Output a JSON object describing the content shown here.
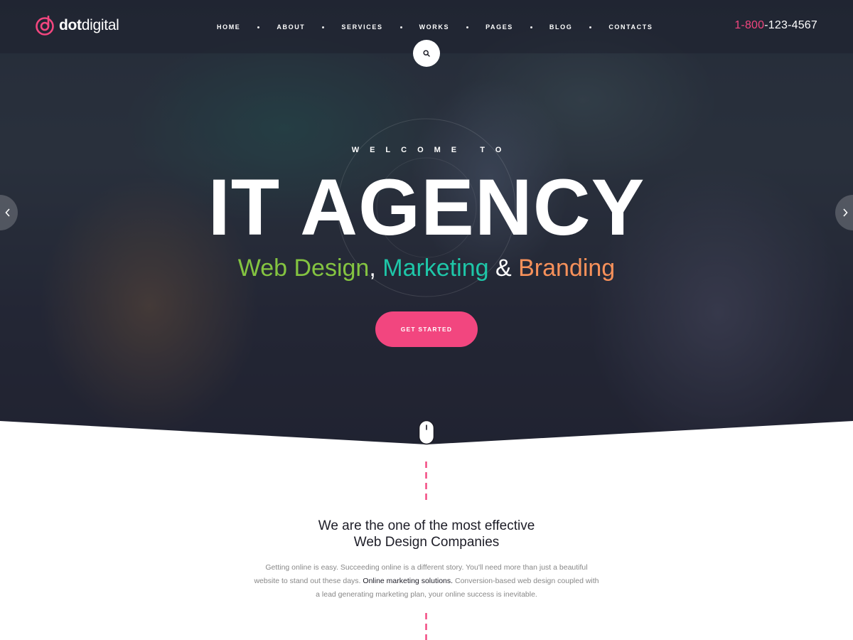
{
  "brand": {
    "logo_bold": "dot",
    "logo_light": "digital",
    "accent": "#f2467f"
  },
  "nav": {
    "items": [
      "HOME",
      "ABOUT",
      "SERVICES",
      "WORKS",
      "PAGES",
      "BLOG",
      "CONTACTS"
    ]
  },
  "header": {
    "phone_prefix": "1-800",
    "phone_rest": "-123-4567",
    "search_icon": "search-icon"
  },
  "hero": {
    "welcome": "WELCOME TO",
    "title": "IT AGENCY",
    "subtitle_part1": "Web Design",
    "subtitle_sep1": ", ",
    "subtitle_part2": "Marketing",
    "subtitle_sep2": " & ",
    "subtitle_part3": "Branding",
    "cta_label": "GET STARTED",
    "colors": {
      "web_design": "#84c441",
      "marketing": "#1ec6a8",
      "branding": "#f7915a"
    }
  },
  "about": {
    "heading_line1": "We are the one of the most effective",
    "heading_line2": "Web Design Companies",
    "text_part1": "Getting online is easy. Succeeding online is a different story. You'll need more than just a beautiful website to stand out these days. ",
    "text_strong": "Online marketing solutions.",
    "text_part2": " Conversion-based web design coupled with a lead generating marketing plan, your online success is inevitable."
  }
}
